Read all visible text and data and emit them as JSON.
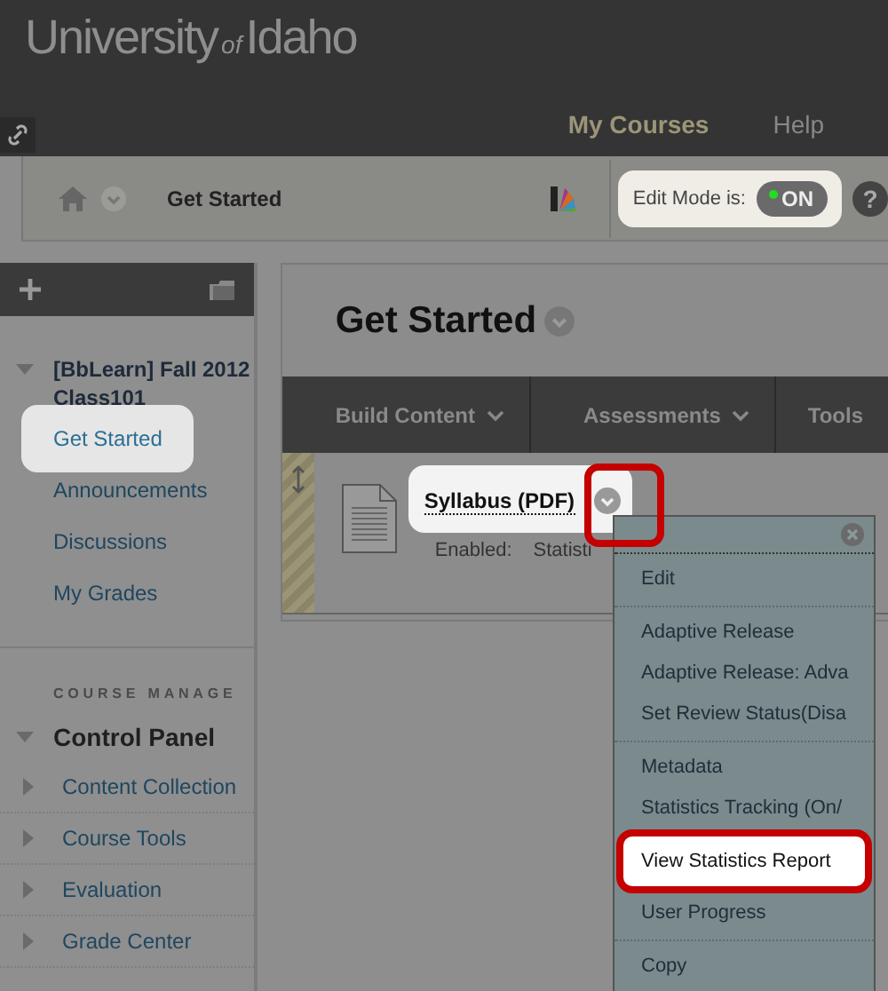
{
  "header": {
    "logo": {
      "name": "University",
      "of": "of",
      "place": "Idaho"
    },
    "nav": [
      {
        "label": "My Courses",
        "selected": true
      },
      {
        "label": "Help",
        "selected": false
      }
    ]
  },
  "breadcrumb": {
    "current": "Get Started",
    "edit_mode": {
      "label": "Edit Mode is:",
      "state": "ON",
      "on": true,
      "highlighted": true
    },
    "help": "?"
  },
  "sidebar": {
    "course": {
      "title": "[BbLearn] Fall 2012 Class101",
      "expanded": true,
      "items": [
        {
          "label": "Get Started",
          "selected": true
        },
        {
          "label": "Announcements",
          "selected": false
        },
        {
          "label": "Discussions",
          "selected": false
        },
        {
          "label": "My Grades",
          "selected": false
        }
      ]
    },
    "section_heading": "COURSE MANAGE",
    "control_panel": {
      "title": "Control Panel",
      "expanded": true,
      "items": [
        {
          "label": "Content Collection",
          "expanded": false
        },
        {
          "label": "Course Tools",
          "expanded": false
        },
        {
          "label": "Evaluation",
          "expanded": false
        },
        {
          "label": "Grade Center",
          "expanded": false
        }
      ]
    }
  },
  "page": {
    "title": "Get Started",
    "action_bar": [
      {
        "label": "Build Content",
        "has_menu": true
      },
      {
        "label": "Assessments",
        "has_menu": true
      },
      {
        "label": "Tools",
        "has_menu": false
      }
    ],
    "item": {
      "title": "Syllabus (PDF)",
      "highlighted": true,
      "meta": [
        "Enabled:",
        "Statisti"
      ]
    }
  },
  "context_menu": {
    "groups": [
      [
        {
          "label": "Edit",
          "selected": false
        }
      ],
      [
        {
          "label": "Adaptive Release",
          "selected": false
        },
        {
          "label": "Adaptive Release: Adva",
          "selected": false
        },
        {
          "label": "Set Review Status(Disa",
          "selected": false
        }
      ],
      [
        {
          "label": "Metadata",
          "selected": false
        },
        {
          "label": "Statistics Tracking (On/",
          "selected": false
        },
        {
          "label": "View Statistics Report",
          "selected": true
        },
        {
          "label": "User Progress",
          "selected": false
        }
      ],
      [
        {
          "label": "Copy",
          "selected": false
        }
      ]
    ]
  }
}
